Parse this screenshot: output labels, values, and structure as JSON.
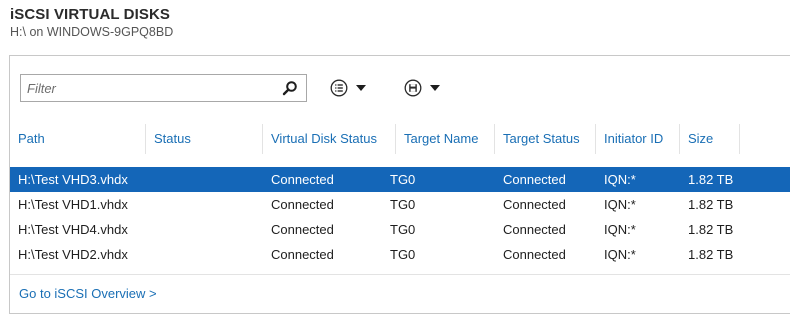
{
  "header": {
    "title": "iSCSI VIRTUAL DISKS",
    "subtitle": "H:\\ on WINDOWS-9GPQ8BD"
  },
  "toolbar": {
    "filter_placeholder": "Filter",
    "icons": [
      "search-icon",
      "list-options-icon",
      "save-icon",
      "chevron-down-icon"
    ]
  },
  "table": {
    "columns": [
      "Path",
      "Status",
      "Virtual Disk Status",
      "Target Name",
      "Target Status",
      "Initiator ID",
      "Size"
    ],
    "rows": [
      {
        "path": "H:\\Test VHD3.vhdx",
        "status": "",
        "virtual_disk_status": "Connected",
        "target_name": "TG0",
        "target_status": "Connected",
        "initiator_id": "IQN:*",
        "size": "1.82 TB",
        "selected": true
      },
      {
        "path": "H:\\Test VHD1.vhdx",
        "status": "",
        "virtual_disk_status": "Connected",
        "target_name": "TG0",
        "target_status": "Connected",
        "initiator_id": "IQN:*",
        "size": "1.82 TB",
        "selected": false
      },
      {
        "path": "H:\\Test VHD4.vhdx",
        "status": "",
        "virtual_disk_status": "Connected",
        "target_name": "TG0",
        "target_status": "Connected",
        "initiator_id": "IQN:*",
        "size": "1.82 TB",
        "selected": false
      },
      {
        "path": "H:\\Test VHD2.vhdx",
        "status": "",
        "virtual_disk_status": "Connected",
        "target_name": "TG0",
        "target_status": "Connected",
        "initiator_id": "IQN:*",
        "size": "1.82 TB",
        "selected": false
      }
    ]
  },
  "footer": {
    "link_label": "Go to iSCSI Overview >"
  },
  "colors": {
    "accent": "#1a6fb5",
    "selection": "#1466b8"
  }
}
